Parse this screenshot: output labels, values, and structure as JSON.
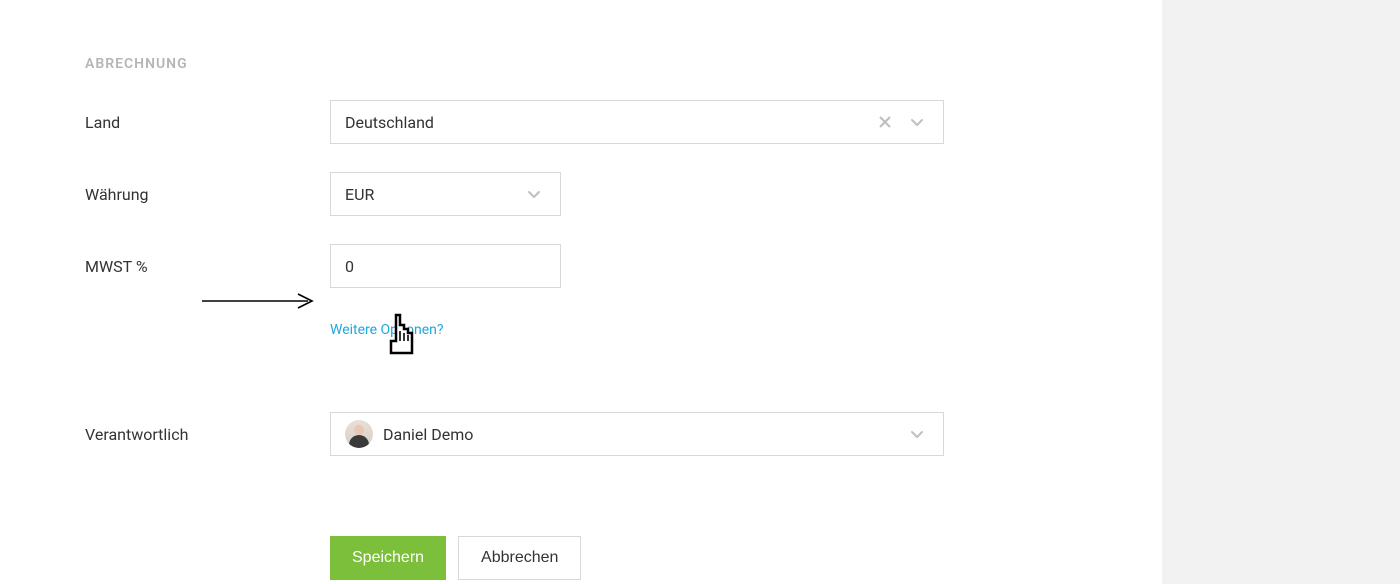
{
  "section": {
    "title": "ABRECHNUNG"
  },
  "fields": {
    "country": {
      "label": "Land",
      "value": "Deutschland"
    },
    "currency": {
      "label": "Währung",
      "value": "EUR"
    },
    "vat": {
      "label": "MWST %",
      "value": "0"
    },
    "responsible": {
      "label": "Verantwortlich",
      "value": "Daniel Demo"
    }
  },
  "moreOptions": {
    "text": "Weitere Optionen?"
  },
  "buttons": {
    "save": "Speichern",
    "cancel": "Abbrechen"
  }
}
